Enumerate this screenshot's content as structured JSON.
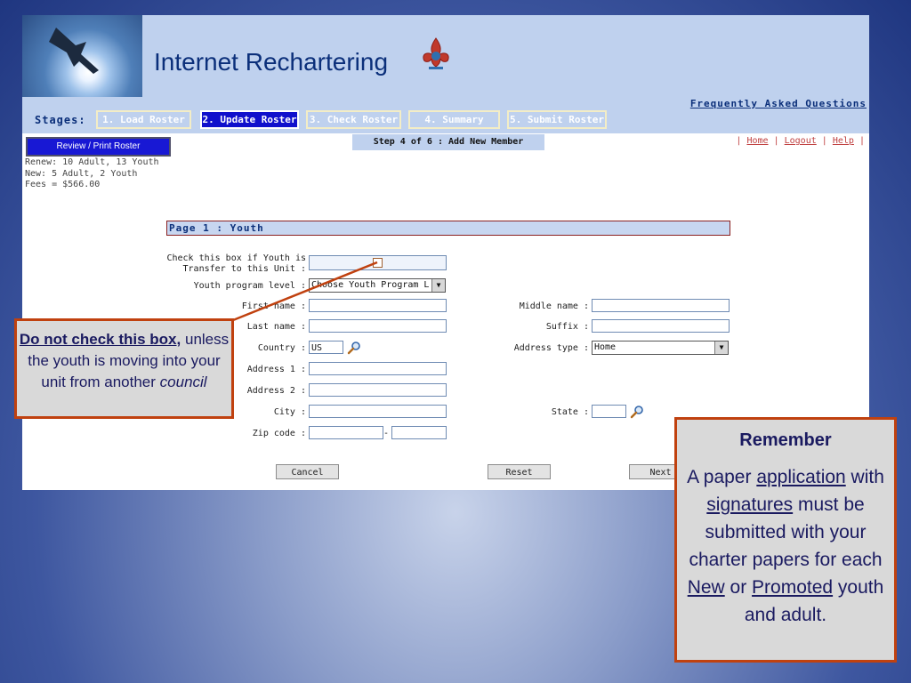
{
  "app": {
    "title": "Internet Rechartering",
    "faq_link": "Frequently Asked Questions",
    "stages_label": "Stages:",
    "stages": [
      {
        "label": "1. Load Roster",
        "active": false
      },
      {
        "label": "2. Update Roster",
        "active": true
      },
      {
        "label": "3. Check Roster",
        "active": false
      },
      {
        "label": "4. Summary",
        "active": false
      },
      {
        "label": "5. Submit Roster",
        "active": false
      }
    ],
    "review_button": "Review / Print Roster",
    "stats": {
      "renew": "Renew: 10 Adult, 13 Youth",
      "new": "New: 5 Adult, 2 Youth",
      "fees": "Fees = $566.00"
    },
    "step": "Step 4 of 6 : Add New Member",
    "links": {
      "home": "Home",
      "logout": "Logout",
      "help": "Help",
      "separator": "|"
    },
    "page_title": "Page 1 : Youth",
    "form": {
      "transfer_label_line1": "Check this box if Youth is",
      "transfer_label_line2": "Transfer to this Unit :",
      "transfer_checked": false,
      "program_level_label": "Youth program level :",
      "program_level_value": "Choose Youth Program L",
      "first_name_label": "First name :",
      "first_name_value": "",
      "middle_name_label": "Middle name :",
      "middle_name_value": "",
      "last_name_label": "Last name :",
      "last_name_value": "",
      "suffix_label": "Suffix :",
      "suffix_value": "",
      "country_label": "Country :",
      "country_value": "US",
      "address_type_label": "Address type :",
      "address_type_value": "Home",
      "address1_label": "Address 1 :",
      "address1_value": "",
      "address2_label": "Address 2 :",
      "address2_value": "",
      "city_label": "City :",
      "city_value": "",
      "state_label": "State :",
      "state_value": "",
      "zip_label": "Zip code :",
      "zip_value": "",
      "zip_ext_value": "",
      "zip_separator": "-"
    },
    "buttons": {
      "cancel": "Cancel",
      "reset": "Reset",
      "next": "Next"
    }
  },
  "callouts": {
    "left": {
      "bold_text": "Do not check this box",
      "comma": ",",
      "line2": "unless the youth is moving into your unit from another",
      "italic": "council"
    },
    "right": {
      "title": "Remember",
      "t1": "A paper ",
      "u1": "application",
      "t2": " with ",
      "u2": "signatures",
      "t3": " must be submitted with your charter papers for each ",
      "u3": "New",
      "t4": " or ",
      "u4": "Promoted",
      "t5": " youth and adult."
    }
  },
  "colors": {
    "header_bg": "#bfd1ee",
    "active_stage": "#1010cc",
    "title_blue": "#0b2f7a",
    "callout_border": "#c0410f",
    "callout_text": "#1a1a60"
  }
}
